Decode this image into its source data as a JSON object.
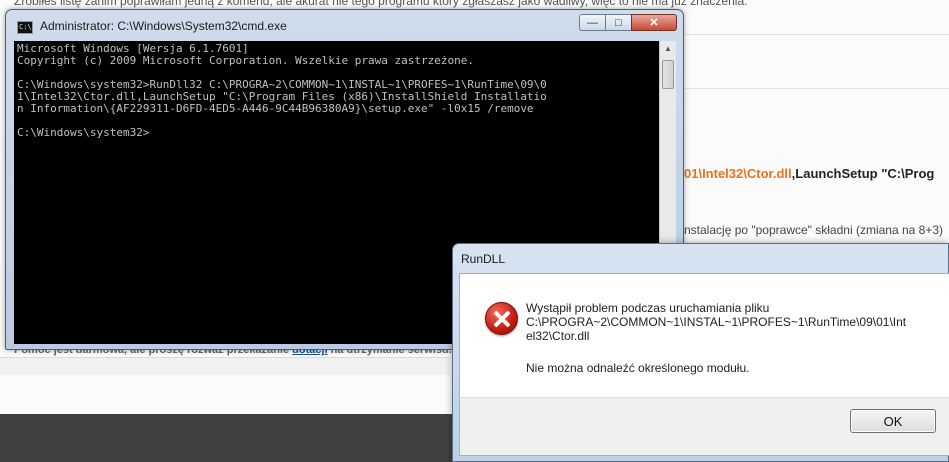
{
  "background_page": {
    "top_text": "Zrobiłeś listę zanim poprawiłam jedną z komend, ale akurat nie tego programu który zgłaszasz jako wadliwy, więc to nie ma już znaczenia.",
    "code_orange": "01\\Intel32\\Ctor.dll",
    "code_plain": ",LaunchSetup \"C:\\Prog",
    "note_text": "nstalację po \"poprawce\" składni (zmiana na 8+3)",
    "donate_text": "Pomoc jest darmowa, ale proszę rozważ przekazanie ",
    "donate_link": "dotacji",
    "donate_tail": " na utrzymanie serwisu."
  },
  "cmd_window": {
    "title": "Administrator: C:\\Windows\\System32\\cmd.exe",
    "buttons": {
      "minimize": "—",
      "maximize": "□",
      "close": "✕"
    },
    "console_text": "Microsoft Windows [Wersja 6.1.7601]\nCopyright (c) 2009 Microsoft Corporation. Wszelkie prawa zastrzeżone.\n\nC:\\Windows\\system32>RunDll32 C:\\PROGRA~2\\COMMON~1\\INSTAL~1\\PROFES~1\\RunTime\\09\\0\n1\\Intel32\\Ctor.dll,LaunchSetup \"C:\\Program Files (x86)\\InstallShield Installatio\nn Information\\{AF229311-D6FD-4ED5-A446-9C44B96380A9}\\setup.exe\" -l0x15 /remove\n\nC:\\Windows\\system32>"
  },
  "rundll_dialog": {
    "title": "RunDLL",
    "message": "Wystąpił problem podczas uruchamiania pliku\nC:\\PROGRA~2\\COMMON~1\\INSTAL~1\\PROFES~1\\RunTime\\09\\01\\Int\nel32\\Ctor.dll",
    "detail": "Nie można odnaleźć określonego modułu.",
    "ok_label": "OK",
    "icon": "error-icon"
  }
}
